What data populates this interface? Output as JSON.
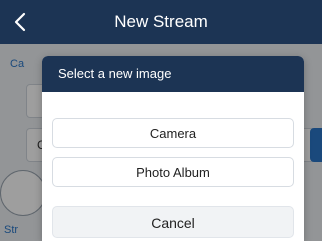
{
  "header": {
    "title": "New Stream",
    "back_icon": "chevron-left-icon"
  },
  "background": {
    "category_label_partial": "Ca",
    "field_label_partial": "C",
    "stream_label_partial": "Str"
  },
  "dialog": {
    "title": "Select a new image",
    "options": [
      {
        "label": "Camera"
      },
      {
        "label": "Photo Album"
      }
    ],
    "cancel_label": "Cancel"
  },
  "colors": {
    "primary": "#1c3454",
    "accent": "#2b77c8"
  }
}
